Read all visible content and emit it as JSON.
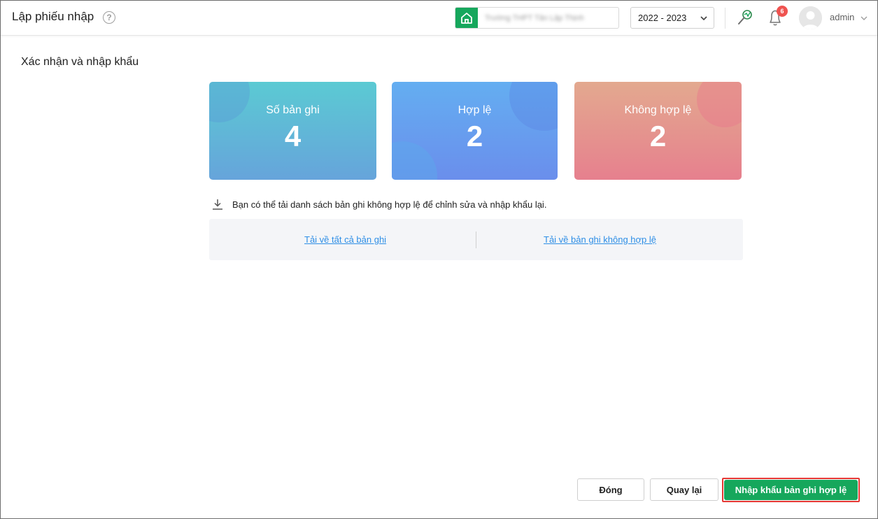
{
  "header": {
    "title": "Lập phiếu nhập",
    "school_name": "Trường THPT Tân Lập Thịnh",
    "year": "2022 - 2023",
    "notification_count": "6",
    "username": "admin"
  },
  "main": {
    "section_title": "Xác nhận và nhập khẩu",
    "cards": [
      {
        "label": "Số bản ghi",
        "value": "4"
      },
      {
        "label": "Hợp lệ",
        "value": "2"
      },
      {
        "label": "Không hợp lệ",
        "value": "2"
      }
    ],
    "hint": "Bạn có thể tải danh sách bản ghi không hợp lệ để chỉnh sửa và nhập khẩu lại.",
    "download_all": "Tải về tất cả bản ghi",
    "download_invalid": "Tải về bản ghi không hợp lệ"
  },
  "footer": {
    "close": "Đóng",
    "back": "Quay lại",
    "import": "Nhập khẩu bản ghi hợp lệ"
  },
  "colors": {
    "brand_green": "#16a75c",
    "link_blue": "#2e8ee6",
    "highlight_red": "#e53935"
  }
}
